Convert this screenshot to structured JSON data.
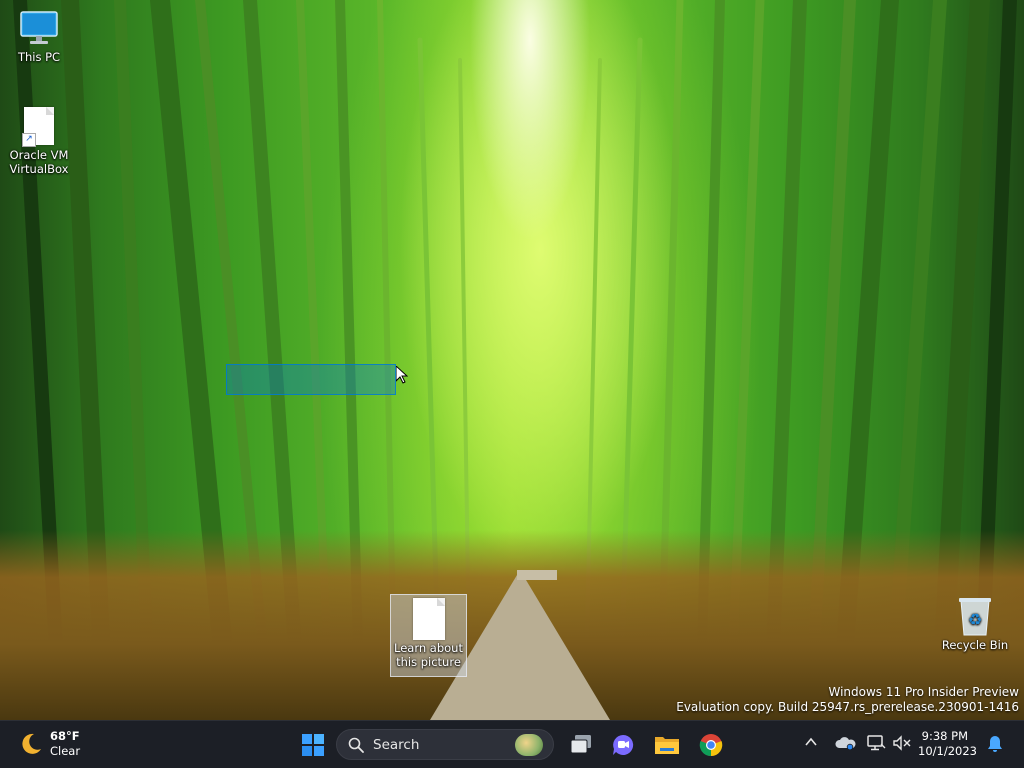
{
  "desktop": {
    "icons": {
      "this_pc": "This PC",
      "vbox_line1": "Oracle VM",
      "vbox_line2": "VirtualBox",
      "learn_line1": "Learn about",
      "learn_line2": "this picture",
      "recycle_bin": "Recycle Bin"
    },
    "watermark": {
      "line1": "Windows 11 Pro Insider Preview",
      "line2": "Evaluation copy. Build 25947.rs_prerelease.230901-1416"
    }
  },
  "taskbar": {
    "weather": {
      "temp": "68°F",
      "condition": "Clear",
      "icon": "moon-icon"
    },
    "search_label": "Search",
    "apps": [
      "start-icon",
      "task-view-icon",
      "teams-icon",
      "file-explorer-icon",
      "chrome-icon"
    ],
    "clock": {
      "time": "9:38 PM",
      "date": "10/1/2023"
    }
  },
  "colors": {
    "taskbar_bg": "#1c1f26",
    "accent": "#0078d4",
    "selection": "#0078d7"
  }
}
